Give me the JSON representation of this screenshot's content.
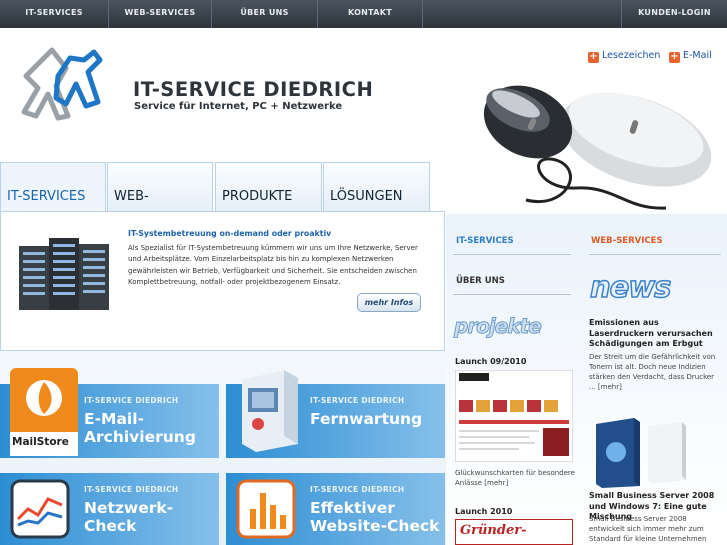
{
  "nav": {
    "items": [
      {
        "label": "IT-SERVICES"
      },
      {
        "label": "WEB-SERVICES"
      },
      {
        "label": "ÜBER UNS"
      },
      {
        "label": "KONTAKT"
      },
      {
        "label": "KUNDEN-LOGIN"
      }
    ]
  },
  "header": {
    "brand_title": "IT-SERVICE DIEDRICH",
    "brand_subtitle": "Service für Internet, PC + Netzwerke",
    "bookmark_label": "Lesezeichen",
    "email_label": "E-Mail"
  },
  "tabs": [
    {
      "label": "IT-SERVICES"
    },
    {
      "label": "WEB-"
    },
    {
      "label": "PRODUKTE"
    },
    {
      "label": "LÖSUNGEN"
    }
  ],
  "main": {
    "heading": "IT-Systembetreuung on-demand oder proaktiv",
    "text": "Als Spezialist für IT-Systembetreuung kümmern wir uns um Ihre Netzwerke, Server und Arbeitsplätze. Vom Einzelarbeitsplatz bis hin zu komplexen Netzwerken gewährleisten wir Betrieb, Verfügbarkeit und Sicherheit. Sie entscheiden zwischen Komplettbetreuung, notfall- oder projektbezogenem Einsatz.",
    "more_label": "mehr Infos"
  },
  "tiles": [
    {
      "small": "IT-SERVICE DIEDRICH",
      "line1": "E-Mail-",
      "line2": "Archivierung",
      "icon_caption": "MailStore"
    },
    {
      "small": "IT-SERVICE DIEDRICH",
      "line1": "Fernwartung",
      "line2": ""
    },
    {
      "small": "IT-SERVICE DIEDRICH",
      "line1": "Netzwerk-Check",
      "line2": ""
    },
    {
      "small": "IT-SERVICE DIEDRICH",
      "line1": "Effektiver",
      "line2": "Website-Check"
    }
  ],
  "sidebar": {
    "left": {
      "link1": "IT-SERVICES",
      "link2": "ÜBER UNS",
      "projekte_logo": "projekte",
      "launch1": "Launch 09/2010",
      "launch1_caption": "Glückwunschkarten für besondere Anlässe [mehr]",
      "launch2": "Launch 2010",
      "launch2_logo": "Gründer-Journal"
    },
    "right": {
      "link1": "WEB-SERVICES",
      "news_logo": "news",
      "news1_title": "Emissionen aus Laserdruckern verursachen Schädigungen am Erbgut",
      "news1_text": "Der Streit um die Gefährlichkeit von Tonern ist alt. Doch neue Indizien stärken den Verdacht, dass Drucker ... [mehr]",
      "news2_title": "Small Business Server 2008 und Windows 7: Eine gute Mischung",
      "news2_text": "Small Business Server 2008 entwickelt sich immer mehr zum Standard für kleine Unternehmen"
    }
  },
  "colors": {
    "nav_bg": "#333b44",
    "link_blue": "#1a55a5",
    "accent_orange": "#e6632e",
    "tile_blue": "#3f97d7"
  }
}
